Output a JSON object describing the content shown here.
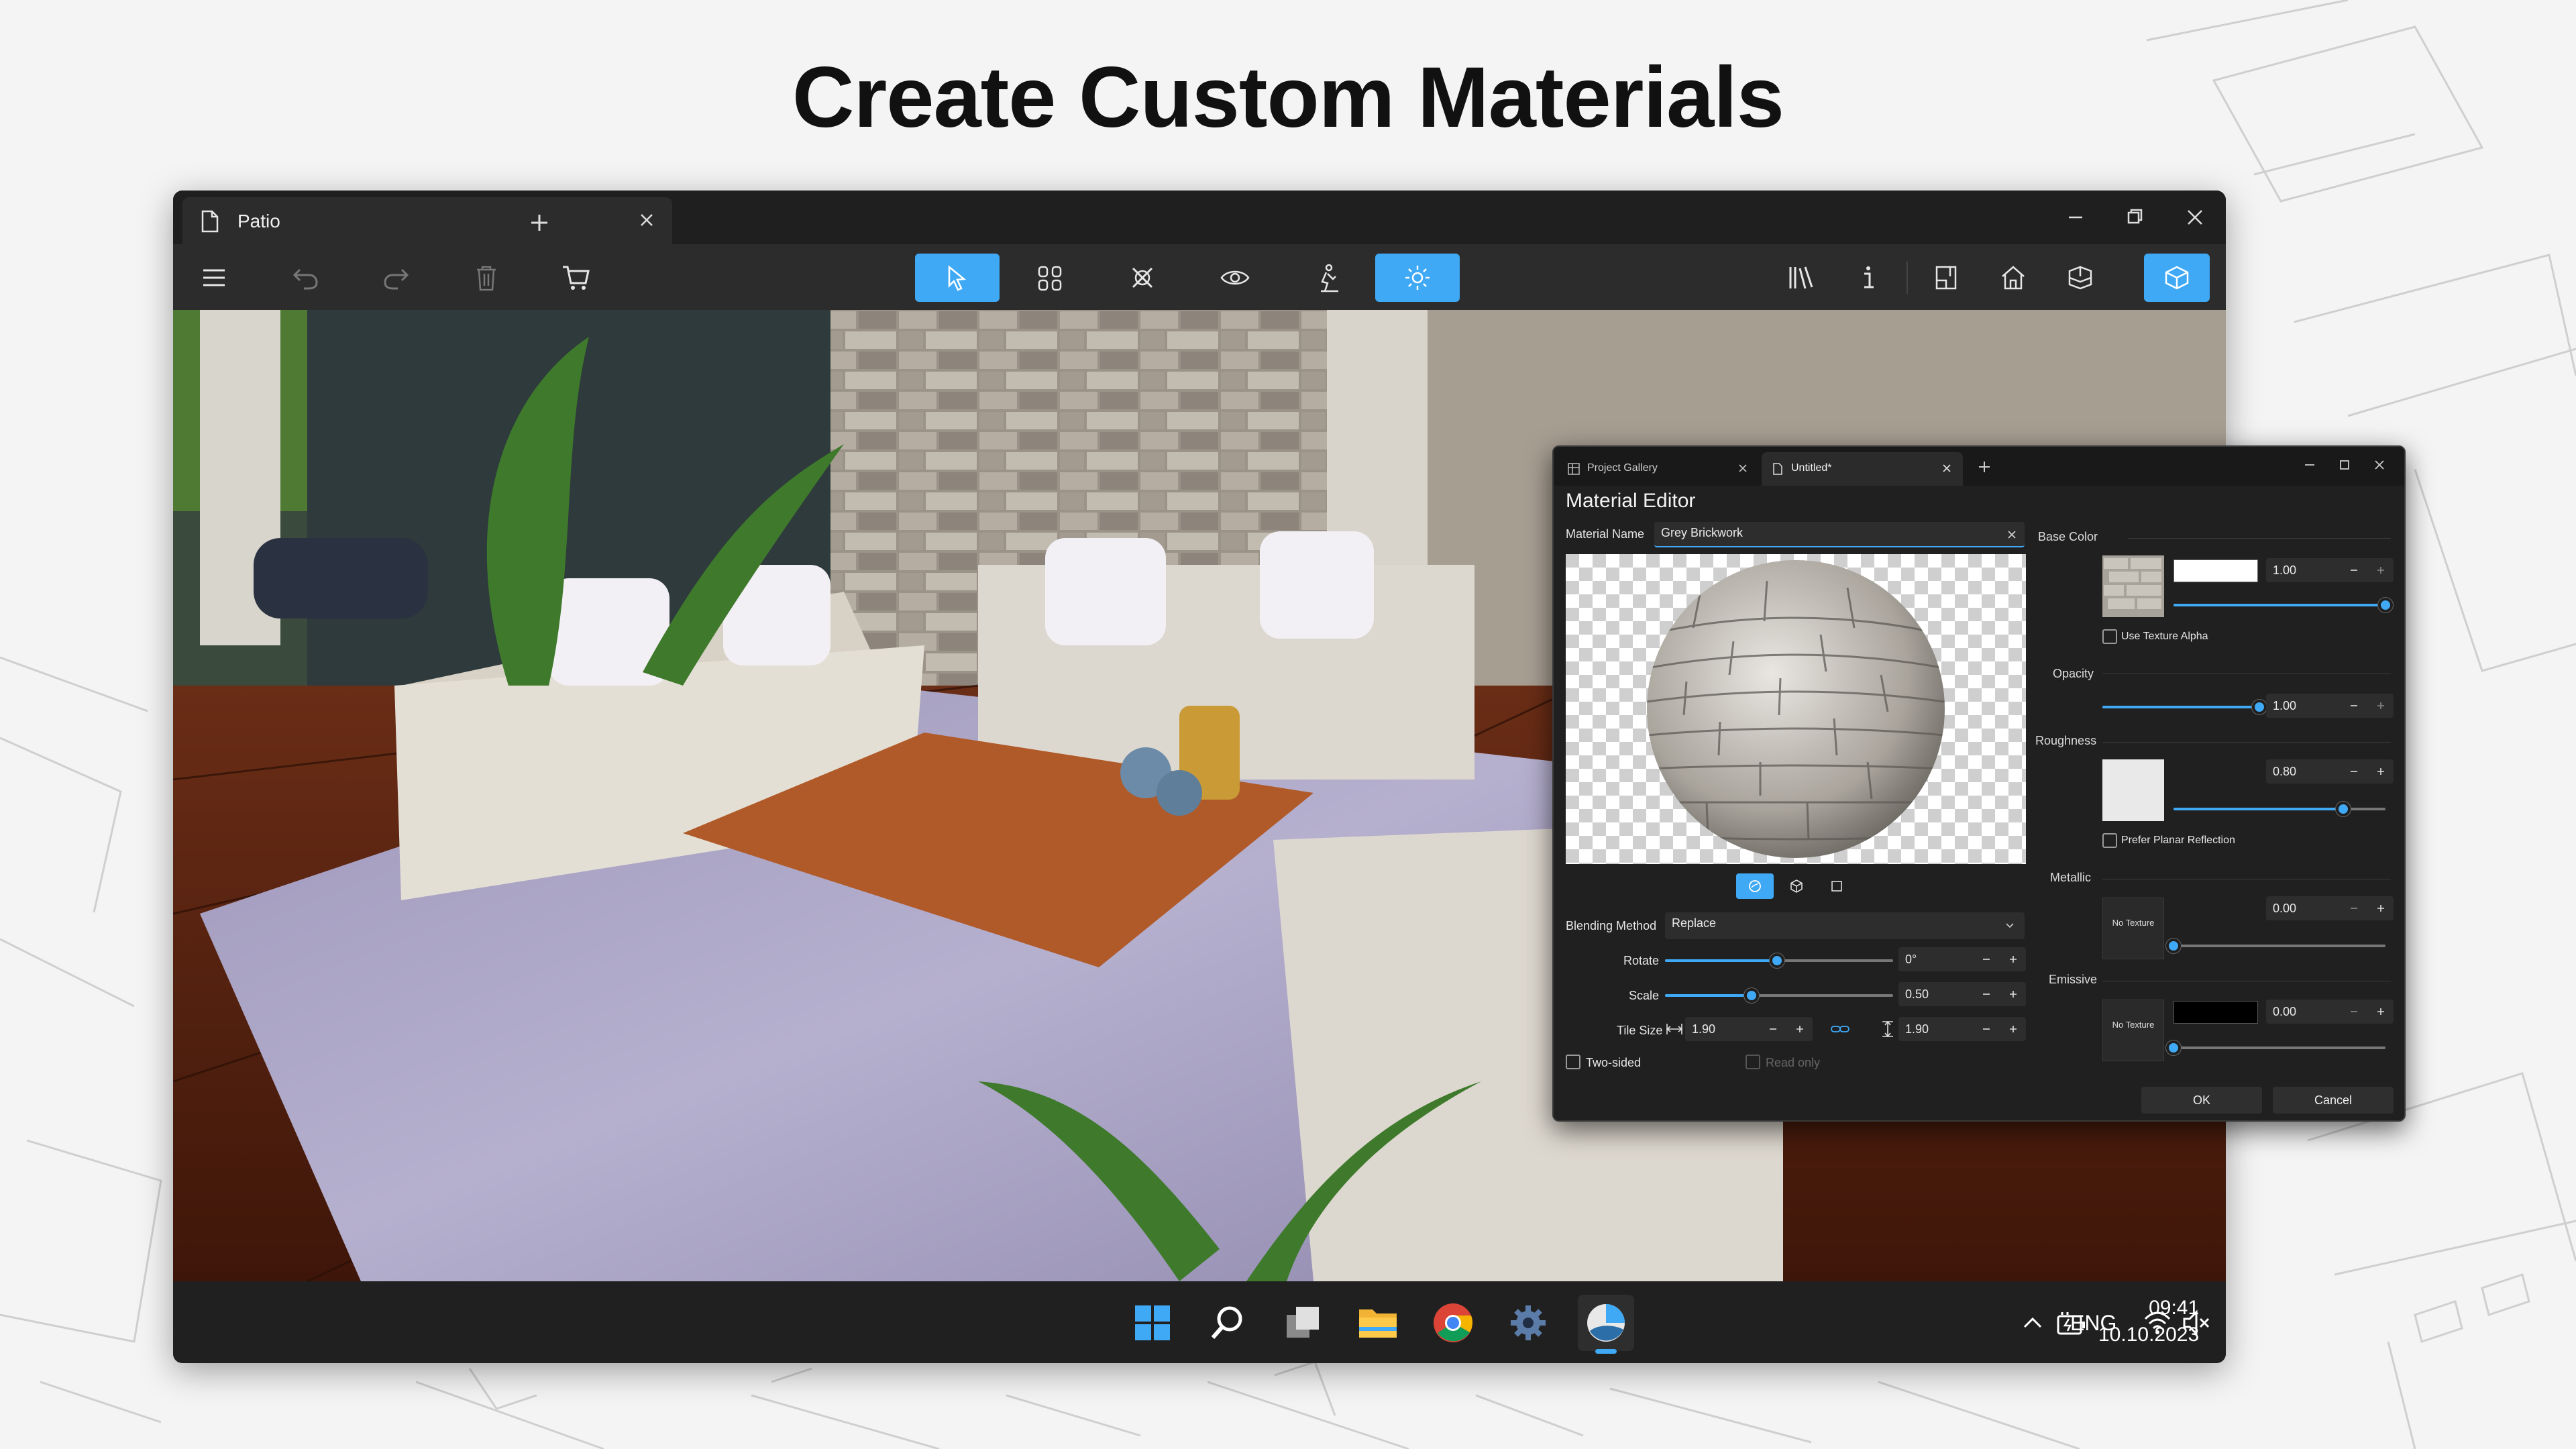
{
  "hero": {
    "title": "Create Custom Materials"
  },
  "window": {
    "tab_title": "Patio",
    "toolbar": {
      "tools": [
        "menu",
        "undo",
        "redo",
        "delete",
        "cart",
        "select",
        "walls",
        "objects",
        "view",
        "people",
        "lighting",
        "library",
        "info",
        "2d-plan",
        "house",
        "3d-plan",
        "3d-view"
      ]
    }
  },
  "editor": {
    "tabs": [
      {
        "label": "Project Gallery",
        "active": false
      },
      {
        "label": "Untitled*",
        "active": true
      }
    ],
    "title": "Material Editor",
    "material_name": {
      "label": "Material Name",
      "value": "Grey Brickwork"
    },
    "blending": {
      "label": "Blending Method",
      "value": "Replace"
    },
    "rotate": {
      "label": "Rotate",
      "value": "0°",
      "level": 0.49
    },
    "scale": {
      "label": "Scale",
      "value": "0.50",
      "level": 0.38
    },
    "tile_size": {
      "label": "Tile Size",
      "width": "1.90",
      "height": "1.90"
    },
    "two_sided": {
      "label": "Two-sided",
      "checked": false
    },
    "read_only": {
      "label": "Read only",
      "checked": false,
      "enabled": false
    },
    "base_color": {
      "label": "Base Color",
      "color": "#ffffff",
      "value": "1.00",
      "level": 1.0,
      "use_alpha_label": "Use Texture Alpha"
    },
    "opacity": {
      "label": "Opacity",
      "value": "1.00",
      "level": 1.0
    },
    "roughness": {
      "label": "Roughness",
      "value": "0.80",
      "level": 0.8,
      "planar_label": "Prefer Planar Reflection"
    },
    "metallic": {
      "label": "Metallic",
      "value": "0.00",
      "level": 0.0,
      "texture_label": "No Texture"
    },
    "emissive": {
      "label": "Emissive",
      "color": "#000000",
      "value": "0.00",
      "level": 0.0,
      "texture_label": "No Texture"
    },
    "ok_label": "OK",
    "cancel_label": "Cancel"
  },
  "taskbar": {
    "language": "ENG",
    "time": "09:41",
    "date": "10.10.2023"
  },
  "colors": {
    "accent": "#3fa9f5",
    "window_bg": "#1e1e1e",
    "toolbar_bg": "#2c2c2c"
  }
}
